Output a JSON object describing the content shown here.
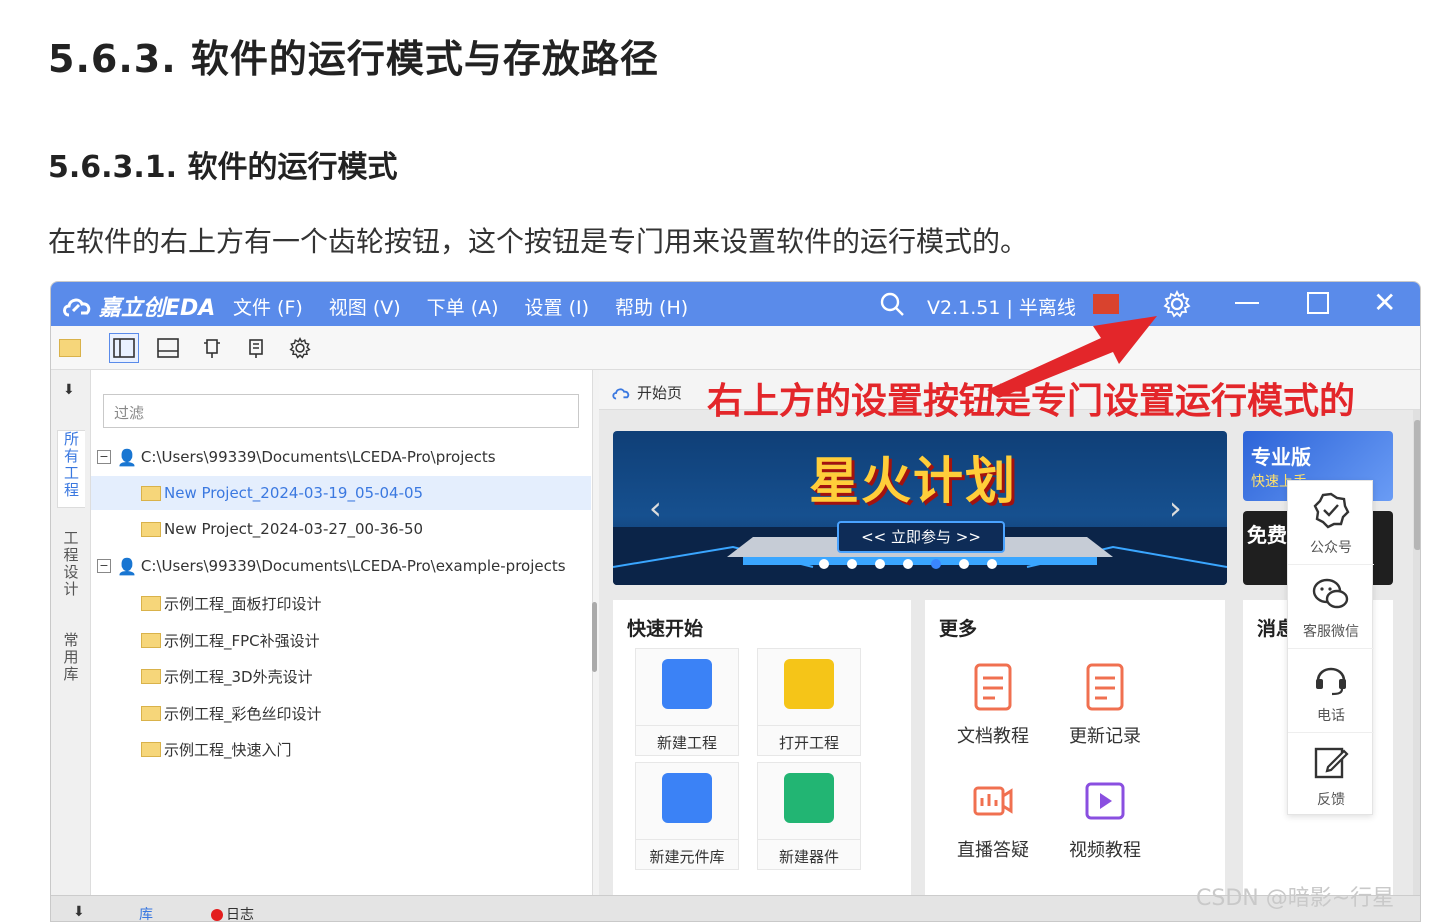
{
  "article": {
    "h3": "5.6.3. 软件的运行模式与存放路径",
    "h4": "5.6.3.1. 软件的运行模式",
    "para": "在软件的右上方有一个齿轮按钮，这个按钮是专门用来设置软件的运行模式的。"
  },
  "app": {
    "logo": "嘉立创EDA",
    "menu": [
      "文件 (F)",
      "视图 (V)",
      "下单 (A)",
      "设置 (I)",
      "帮助 (H)"
    ],
    "version": "V2.1.51 | 半离线",
    "accent": "#5a8bea"
  },
  "left": {
    "vtabs": [
      "所有工程",
      "工程设计",
      "常用库"
    ],
    "filter_placeholder": "过滤",
    "tree": [
      {
        "text": "C:\\Users\\99339\\Documents\\LCEDA-Pro\\projects",
        "kind": "root"
      },
      {
        "text": "New Project_2024-03-19_05-04-05",
        "kind": "project",
        "selected": true
      },
      {
        "text": "New Project_2024-03-27_00-36-50",
        "kind": "project"
      },
      {
        "text": "C:\\Users\\99339\\Documents\\LCEDA-Pro\\example-projects",
        "kind": "root"
      },
      {
        "text": "示例工程_面板打印设计",
        "kind": "project"
      },
      {
        "text": "示例工程_FPC补强设计",
        "kind": "project"
      },
      {
        "text": "示例工程_3D外壳设计",
        "kind": "project"
      },
      {
        "text": "示例工程_彩色丝印设计",
        "kind": "project"
      },
      {
        "text": "示例工程_快速入门",
        "kind": "project"
      }
    ]
  },
  "right": {
    "home_tab": "开始页",
    "annotation": "右上方的设置按钮是专门设置运行模式的",
    "banner": {
      "title": "星火计划",
      "button": "<< 立即参与 >>"
    },
    "promo": {
      "title": "专业版",
      "sub": "快速上手"
    },
    "promo2": {
      "title": "免费"
    },
    "quick": {
      "title": "快速开始",
      "items": [
        "新建工程",
        "打开工程",
        "新建元件库",
        "新建器件"
      ]
    },
    "more": {
      "title": "更多",
      "items": [
        "文档教程",
        "更新记录",
        "直播答疑",
        "视频教程"
      ]
    },
    "msg_title": "消息",
    "float": [
      "公众号",
      "客服微信",
      "电话",
      "反馈"
    ]
  },
  "bottom": {
    "items": [
      "库",
      "日志"
    ]
  },
  "watermark": "CSDN @暗影~行星"
}
